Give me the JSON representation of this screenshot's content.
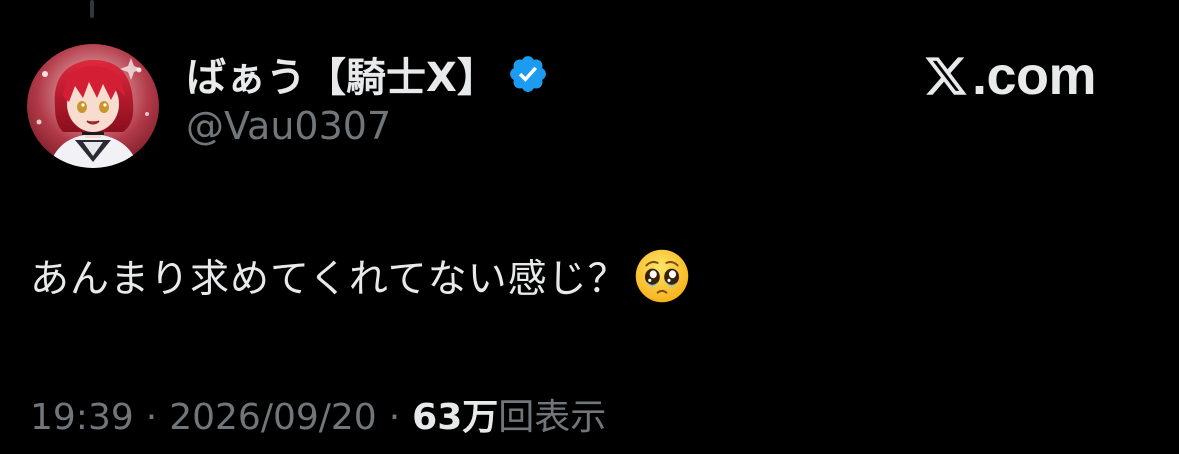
{
  "tweet": {
    "author": {
      "display_name": "ばぁう【騎士X】",
      "handle": "@Vau0307",
      "verified": true,
      "avatar": "red-haired-character-avatar"
    },
    "brand": {
      "icon": "x-logo-icon",
      "text": ".com"
    },
    "text": "あんまり求めてくれてない感じ？",
    "emoji": "pleading-face-emoji",
    "meta": {
      "time": "19:39",
      "separator": "·",
      "date": "2026/09/20",
      "views_count": "63万",
      "views_label": "回表示"
    }
  },
  "colors": {
    "background": "#000000",
    "primary_text": "#e7e9ea",
    "secondary_text": "#71767b",
    "verified_badge": "#1d9bf0"
  }
}
